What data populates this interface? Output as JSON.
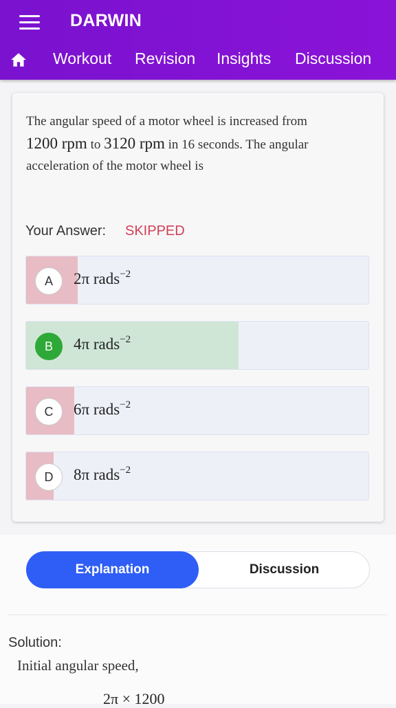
{
  "header": {
    "title": "DARWIN",
    "tabs": [
      {
        "label": "Workout"
      },
      {
        "label": "Revision"
      },
      {
        "label": "Insights"
      },
      {
        "label": "Discussion"
      }
    ]
  },
  "question": {
    "text_1": "The angular speed of a motor wheel is increased from",
    "val_1": "1200 rpm",
    "text_2": "to",
    "val_2": "3120 rpm",
    "text_3": "in 16 seconds. The angular",
    "text_4": "acceleration of the motor wheel is"
  },
  "answer": {
    "label": "Your Answer:",
    "status": "SKIPPED"
  },
  "options": [
    {
      "letter": "A",
      "value": "2π rads",
      "exp": "−2",
      "response_share": 0.15,
      "fill_color": "#e8bcc4"
    },
    {
      "letter": "B",
      "value": "4π rads",
      "exp": "−2",
      "response_share": 0.62,
      "fill_color": "#cfe6d6",
      "correct": true
    },
    {
      "letter": "C",
      "value": "6π rads",
      "exp": "−2",
      "response_share": 0.14,
      "fill_color": "#e8bcc4"
    },
    {
      "letter": "D",
      "value": "8π rads",
      "exp": "−2",
      "response_share": 0.08,
      "fill_color": "#e8bcc4"
    }
  ],
  "toggle": {
    "explanation": "Explanation",
    "discussion": "Discussion"
  },
  "solution": {
    "label": "Solution:",
    "line_1": "Initial angular speed,",
    "formula_partial": "2π × 1200"
  },
  "colors": {
    "header_purple": "#7a12cf",
    "accent_blue": "#2f5ef6",
    "skipped_red": "#d23f55",
    "correct_green": "#2ea836"
  }
}
